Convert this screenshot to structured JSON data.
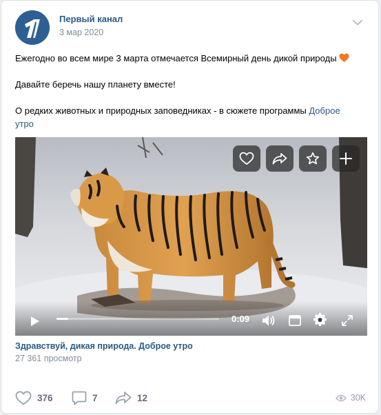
{
  "post": {
    "author": "Первый канал",
    "date": "3 мар 2020",
    "text_line1": "Ежегодно во всем мире 3 марта отмечается Всемирный день дикой природы",
    "text_line2": "Давайте беречь нашу планету вместе!",
    "text_line3_prefix": "О редких животных и природных заповедниках - в сюжете программы",
    "text_line3_link": "Доброе утро"
  },
  "video": {
    "time": "0:09",
    "progress_fraction": 0.07,
    "title": "Здравствуй, дикая природа. Доброе утро",
    "views": "27 361 просмотр"
  },
  "stats": {
    "likes": "376",
    "comments": "7",
    "shares": "12",
    "views": "30K"
  },
  "colors": {
    "link": "#2a5885",
    "muted": "#818c99",
    "brand_avatar": "#2a5c8e"
  }
}
